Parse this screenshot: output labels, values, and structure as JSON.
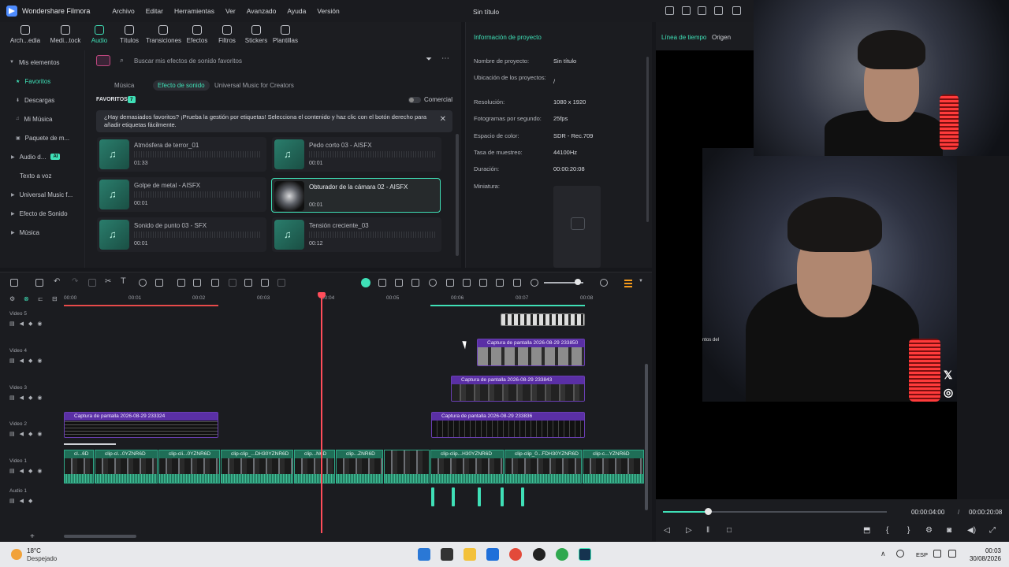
{
  "app": {
    "name": "Wondershare Filmora",
    "project_title": "Sin título"
  },
  "menu": [
    "Archivo",
    "Editar",
    "Herramientas",
    "Ver",
    "Avanzado",
    "Ayuda",
    "Versión"
  ],
  "toolbar": [
    {
      "label": "Arch...edia",
      "icon": "folder-icon"
    },
    {
      "label": "Medi...tock",
      "icon": "stock-media-icon"
    },
    {
      "label": "Audio",
      "icon": "music-note-icon",
      "active": true
    },
    {
      "label": "Títulos",
      "icon": "text-icon"
    },
    {
      "label": "Transiciones",
      "icon": "transition-icon"
    },
    {
      "label": "Efectos",
      "icon": "effects-icon"
    },
    {
      "label": "Filtros",
      "icon": "filters-icon"
    },
    {
      "label": "Stickers",
      "icon": "sticker-icon"
    },
    {
      "label": "Plantillas",
      "icon": "templates-icon"
    }
  ],
  "left_nav": {
    "items": [
      "Mis elementos",
      "Favoritos",
      "Descargas",
      "Mi Música",
      "Paquete de m...",
      "Audio d...",
      "Texto a voz",
      "Universal Music f...",
      "Efecto de Sonido",
      "Música"
    ],
    "ai_badge": "AI"
  },
  "library": {
    "search_placeholder": "Buscar mis efectos de sonido favoritos",
    "tabs": [
      "Música",
      "Efecto de sonido",
      "Universal Music for Creators"
    ],
    "favorites_label": "FAVORITOS",
    "favorites_count": "7",
    "commercial_label": "Comercial",
    "tip": "¿Hay demasiados favoritos? ¡Prueba la gestión por etiquetas! Selecciona el contenido y haz clic con el botón derecho para añadir etiquetas fácilmente.",
    "sounds": [
      {
        "name": "Atmósfera de terror_01",
        "duration": "01:33"
      },
      {
        "name": "Pedo corto 03 - AISFX",
        "duration": "00:01"
      },
      {
        "name": "Golpe de metal - AISFX",
        "duration": "00:01"
      },
      {
        "name": "Obturador de la cámara 02 - AISFX",
        "duration": "00:01"
      },
      {
        "name": "Sonido de punto 03 - SFX",
        "duration": "00:01"
      },
      {
        "name": "Tensión creciente_03",
        "duration": "00:12"
      }
    ]
  },
  "project_info": {
    "title": "Información de proyecto",
    "rows": [
      {
        "label": "Nombre de proyecto:",
        "value": "Sin título"
      },
      {
        "label": "Ubicación de los proyectos:",
        "value": "/"
      },
      {
        "label": "Resolución:",
        "value": "1080 x 1920"
      },
      {
        "label": "Fotogramas por segundo:",
        "value": "25fps"
      },
      {
        "label": "Espacio de color:",
        "value": "SDR - Rec.709"
      },
      {
        "label": "Tasa de muestreo:",
        "value": "44100Hz"
      },
      {
        "label": "Duración:",
        "value": "00:00:20:08"
      },
      {
        "label": "Miniatura:",
        "value": ""
      }
    ]
  },
  "preview": {
    "tabs": [
      "Línea de tiempo",
      "Origen"
    ],
    "time_current": "00:00:04:00",
    "time_separator": "/",
    "time_total": "00:00:20:08",
    "progress_fraction": 0.2,
    "side_text": "ntos del"
  },
  "timeline": {
    "ruler_ticks": [
      "00:00",
      "00:01",
      "00:02",
      "00:03",
      "00:04",
      "00:05",
      "00:06",
      "00:07",
      "00:08"
    ],
    "tracks": [
      "Video 5",
      "Video 4",
      "Video 3",
      "Video 2",
      "Video 1",
      "Audio 1"
    ],
    "clips": {
      "v4": "Captura de pantalla 2026-08-29 233850",
      "v3": "Captura de pantalla 2026-08-29 233843",
      "v2a": "Captura de pantalla 2026-08-29 233324",
      "v2b": "Captura de pantalla 2026-08-29 233836",
      "main": [
        "cl...6D",
        "clip-cl...0YZNR6D",
        "clip-cli...0YZNR6D",
        "clip-clip_...DH30YZNR6D",
        "clip...N6D",
        "clip...ZNR6D",
        "clip-clip...H30YZNR6D",
        "clip-clip_0...FDH30YZNR6D",
        "clip-c...YZNR6D"
      ]
    },
    "colors": {
      "accent": "#3fe0b7",
      "clip_purple": "#5a2fa5",
      "main_clip": "#1f6e57",
      "playhead": "#ff4d5a"
    }
  },
  "taskbar": {
    "temp": "18°C",
    "weather": "Despejado",
    "lang": "ESP",
    "time": "00:03",
    "date": "30/08/2026"
  }
}
